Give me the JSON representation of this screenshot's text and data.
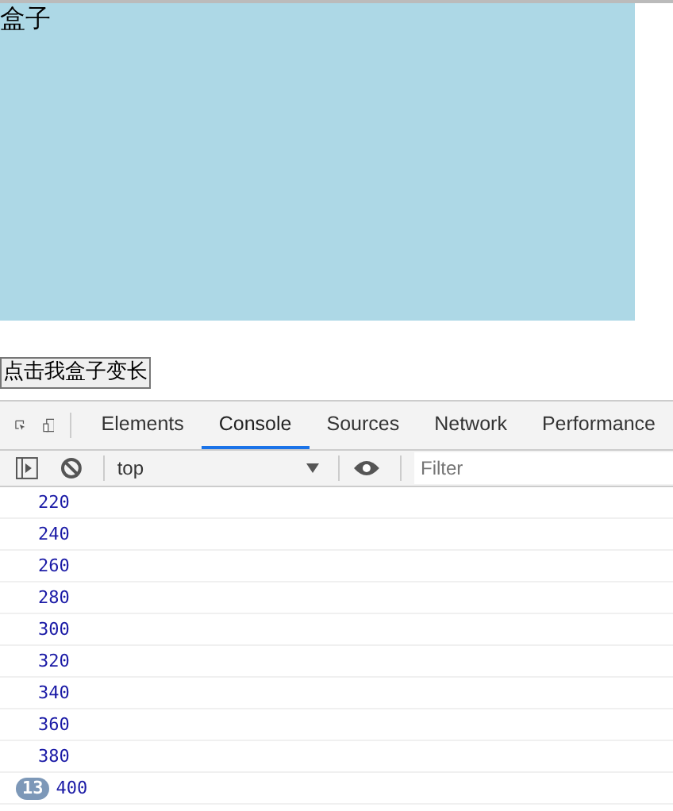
{
  "page": {
    "box_label": "盒子",
    "button": "点击我盒子变长"
  },
  "devtools": {
    "tabs": [
      {
        "label": "Elements",
        "selected": false
      },
      {
        "label": "Console",
        "selected": true
      },
      {
        "label": "Sources",
        "selected": false
      },
      {
        "label": "Network",
        "selected": false
      },
      {
        "label": "Performance",
        "selected": false
      }
    ],
    "context": "top",
    "filter": {
      "placeholder": "Filter"
    },
    "messages": [
      {
        "text": "220"
      },
      {
        "text": "240"
      },
      {
        "text": "260"
      },
      {
        "text": "280"
      },
      {
        "text": "300"
      },
      {
        "text": "320"
      },
      {
        "text": "340"
      },
      {
        "text": "360"
      },
      {
        "text": "380"
      },
      {
        "text": "400",
        "count": "13"
      }
    ]
  }
}
